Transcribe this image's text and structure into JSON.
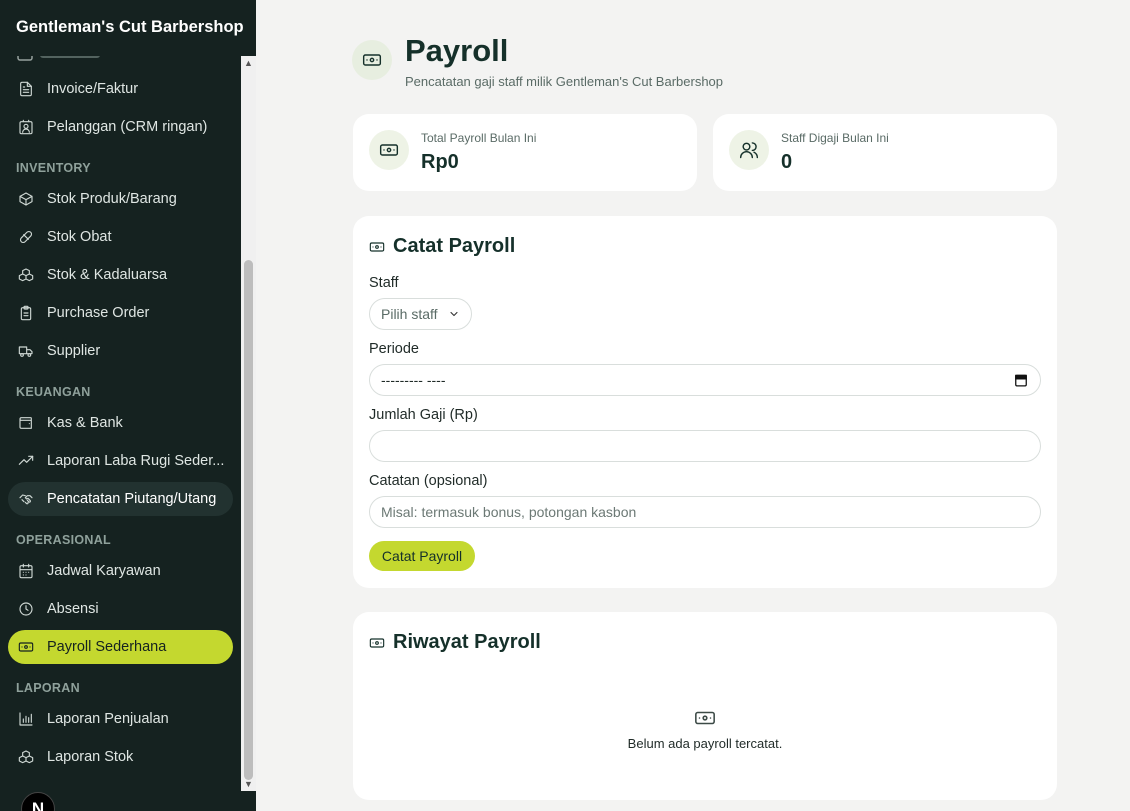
{
  "app": {
    "brand": "Gentleman's Cut Barbershop"
  },
  "sidebar": {
    "items_top": [
      {
        "label": "Invoice/Faktur",
        "icon": "file-icon"
      },
      {
        "label": "Pelanggan (CRM ringan)",
        "icon": "contact-icon"
      }
    ],
    "sections": [
      {
        "title": "INVENTORY",
        "items": [
          {
            "label": "Stok Produk/Barang",
            "icon": "package-icon"
          },
          {
            "label": "Stok Obat",
            "icon": "pill-icon"
          },
          {
            "label": "Stok & Kadaluarsa",
            "icon": "boxes-icon"
          },
          {
            "label": "Purchase Order",
            "icon": "clipboard-icon"
          },
          {
            "label": "Supplier",
            "icon": "truck-icon"
          }
        ]
      },
      {
        "title": "KEUANGAN",
        "items": [
          {
            "label": "Kas & Bank",
            "icon": "wallet-icon"
          },
          {
            "label": "Laporan Laba Rugi Seder...",
            "icon": "trending-up-icon"
          },
          {
            "label": "Pencatatan Piutang/Utang",
            "icon": "handshake-icon"
          }
        ]
      },
      {
        "title": "OPERASIONAL",
        "items": [
          {
            "label": "Jadwal Karyawan",
            "icon": "calendar-icon"
          },
          {
            "label": "Absensi",
            "icon": "clock-icon"
          },
          {
            "label": "Payroll Sederhana",
            "icon": "banknote-icon"
          }
        ]
      },
      {
        "title": "LAPORAN",
        "items": [
          {
            "label": "Laporan Penjualan",
            "icon": "bar-chart-icon"
          },
          {
            "label": "Laporan Stok",
            "icon": "boxes-icon"
          }
        ]
      }
    ],
    "active": "Payroll Sederhana",
    "hovered": "Pencatatan Piutang/Utang"
  },
  "header": {
    "title": "Payroll",
    "subtitle": "Pencatatan gaji staff milik Gentleman's Cut Barbershop"
  },
  "stats": [
    {
      "label": "Total Payroll Bulan Ini",
      "value": "Rp0",
      "icon": "banknote-icon"
    },
    {
      "label": "Staff Digaji Bulan Ini",
      "value": "0",
      "icon": "users-icon"
    }
  ],
  "form": {
    "title": "Catat Payroll",
    "staff_label": "Staff",
    "staff_value": "Pilih staff",
    "periode_label": "Periode",
    "periode_value": "--------- ----",
    "gaji_label": "Jumlah Gaji (Rp)",
    "gaji_value": "",
    "catatan_label": "Catatan (opsional)",
    "catatan_placeholder": "Misal: termasuk bonus, potongan kasbon",
    "submit_label": "Catat Payroll"
  },
  "history": {
    "title": "Riwayat Payroll",
    "empty_text": "Belum ada payroll tercatat."
  },
  "colors": {
    "sidebar_bg": "#152220",
    "accent": "#c4d82f",
    "page_bg": "#f3f3f2"
  },
  "misc": {
    "badge_letter": "N"
  }
}
